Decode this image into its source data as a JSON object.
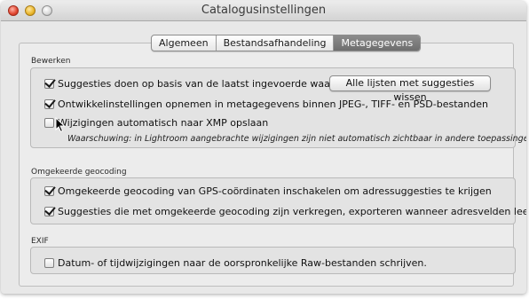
{
  "window": {
    "title": "Catalogusinstellingen"
  },
  "tabs": [
    {
      "label": "Algemeen",
      "active": false
    },
    {
      "label": "Bestandsafhandeling",
      "active": false
    },
    {
      "label": "Metagegevens",
      "active": true
    }
  ],
  "sections": {
    "bewerken": {
      "label": "Bewerken",
      "suggesties": {
        "label": "Suggesties doen op basis van de laatst ingevoerde waarden",
        "checked": true
      },
      "clear_button": "Alle lijsten met suggesties wissen",
      "ontwikkel": {
        "label": "Ontwikkelinstellingen opnemen in metagegevens binnen JPEG-, TIFF- en PSD-bestanden",
        "checked": true
      },
      "xmp": {
        "label": "Wijzigingen automatisch naar XMP opslaan",
        "checked": false
      },
      "warning": "Waarschuwing: in Lightroom aangebrachte wijzigingen zijn niet automatisch zichtbaar in andere toepassingen."
    },
    "geocoding": {
      "label": "Omgekeerde geocoding",
      "gps": {
        "label": "Omgekeerde geocoding van GPS-coördinaten inschakelen om adressuggesties te krijgen",
        "checked": true
      },
      "export": {
        "label": "Suggesties die met omgekeerde geocoding zijn verkregen, exporteren wanneer adresvelden leeg zijn",
        "checked": true
      }
    },
    "exif": {
      "label": "EXIF",
      "datum": {
        "label": "Datum- of tijdwijzigingen naar de oorspronkelijke Raw-bestanden schrijven.",
        "checked": false
      }
    }
  },
  "colors": {
    "active_tab": "#7a7a7a",
    "window_bg": "#e8e8e8"
  },
  "icons": [
    "close-icon",
    "minimize-icon",
    "zoom-icon",
    "checkmark-icon",
    "mouse-pointer-icon"
  ]
}
